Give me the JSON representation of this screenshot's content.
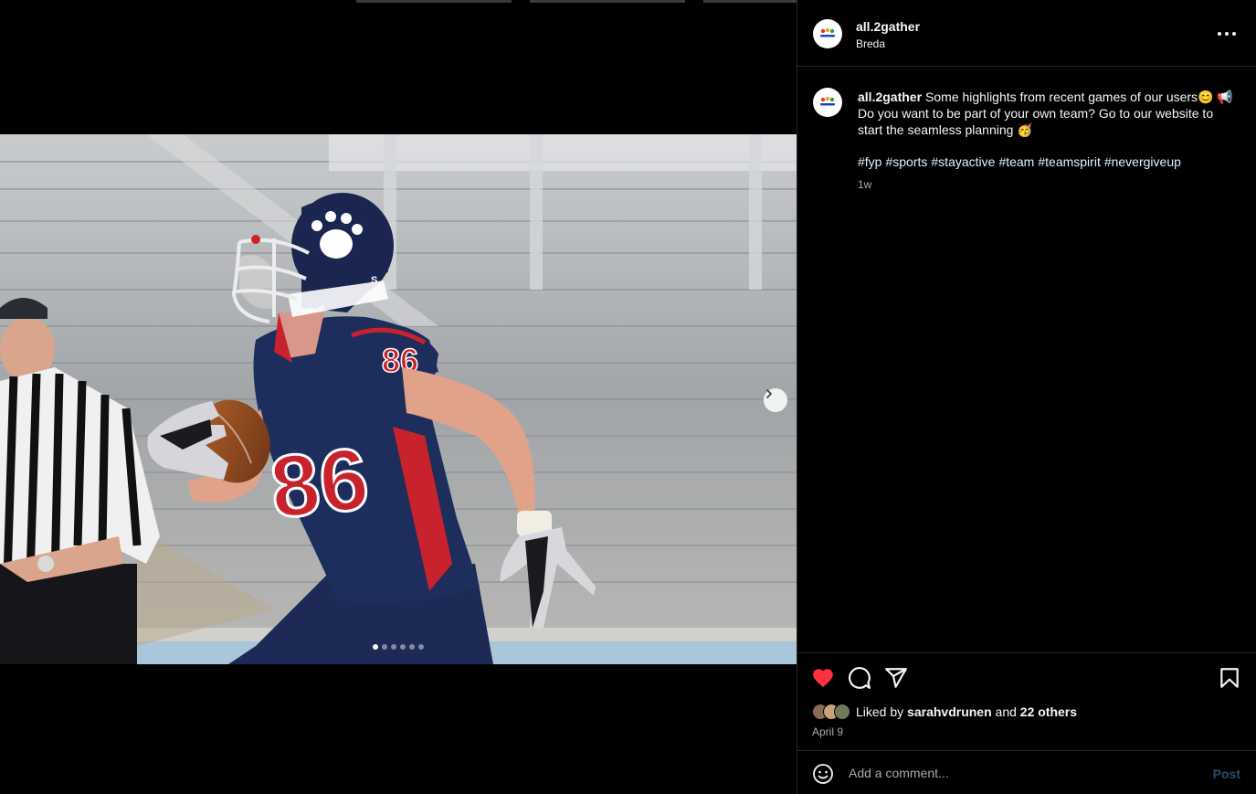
{
  "post": {
    "username": "all.2gather",
    "location": "Breda",
    "avatar_logo_text": "All2Gather",
    "caption_text": "Some highlights from recent games of our users😊 📢 Do you want to be part of your own team? Go to our website to start the seamless planning 🥳",
    "hashtags": [
      "#fyp",
      "#sports",
      "#stayactive",
      "#team",
      "#teamspirit",
      "#nevergiveup"
    ],
    "time_ago": "1w",
    "liked_by_prefix": "Liked by",
    "liked_by_user": "sarahvdrunen",
    "liked_by_and": "and",
    "liked_by_others": "22 others",
    "date": "April 9"
  },
  "media": {
    "jersey_number": "86",
    "carousel_count": 6,
    "carousel_active_index": 0
  },
  "comment": {
    "placeholder": "Add a comment...",
    "post_label": "Post"
  },
  "icons": {
    "like": "heart-icon",
    "comment": "comment-icon",
    "share": "share-icon",
    "save": "bookmark-icon",
    "emoji": "emoji-icon",
    "more": "more-icon",
    "next": "chevron-right-icon"
  },
  "colors": {
    "like_active": "#ff3040",
    "post_disabled": "#2a4a6f"
  }
}
